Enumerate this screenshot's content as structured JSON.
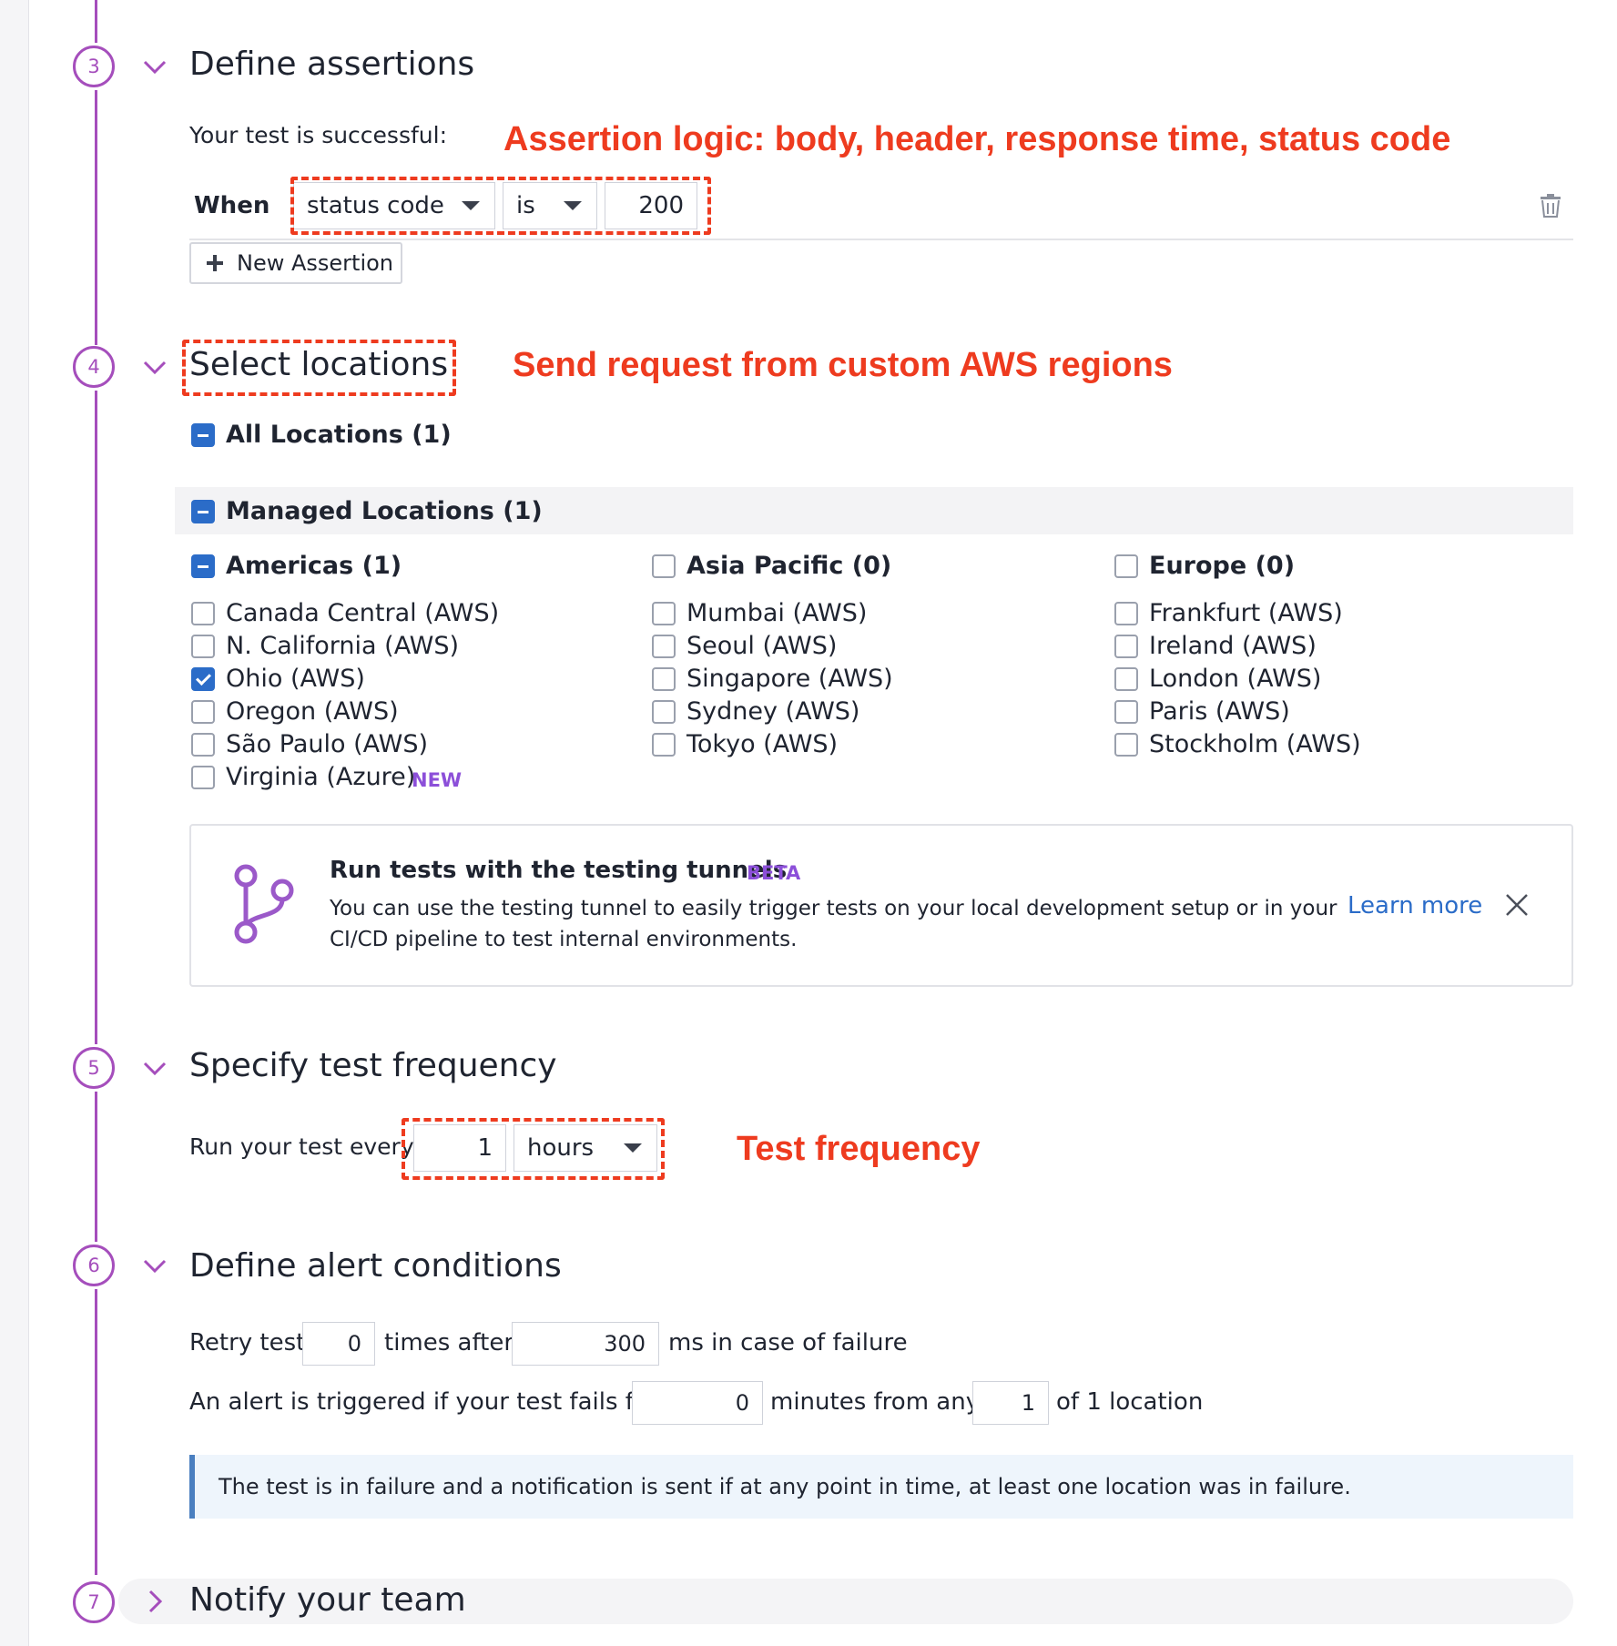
{
  "steps": [
    {
      "number": "3",
      "title": "Define assertions"
    },
    {
      "number": "4",
      "title": "Select locations"
    },
    {
      "number": "5",
      "title": "Specify test frequency"
    },
    {
      "number": "6",
      "title": "Define alert conditions"
    },
    {
      "number": "7",
      "title": "Notify your team"
    }
  ],
  "annotations": {
    "assertion": "Assertion logic: body, header, response time, status code",
    "locations": "Send request from custom AWS regions",
    "frequency": "Test frequency"
  },
  "assertions": {
    "intro": "Your test is successful:",
    "when_label": "When",
    "field": "status code",
    "operator": "is",
    "value": "200",
    "new_button": "New Assertion"
  },
  "locations": {
    "all": "All Locations (1)",
    "managed": "Managed Locations (1)",
    "regions": [
      {
        "title": "Americas (1)",
        "state": "indeterminate",
        "items": [
          {
            "label": "Canada Central (AWS)",
            "checked": false
          },
          {
            "label": "N. California (AWS)",
            "checked": false
          },
          {
            "label": "Ohio (AWS)",
            "checked": true
          },
          {
            "label": "Oregon (AWS)",
            "checked": false
          },
          {
            "label": "São Paulo (AWS)",
            "checked": false
          },
          {
            "label": "Virginia (Azure)",
            "checked": false,
            "badge": "NEW"
          }
        ]
      },
      {
        "title": "Asia Pacific (0)",
        "state": "unchecked",
        "items": [
          {
            "label": "Mumbai (AWS)",
            "checked": false
          },
          {
            "label": "Seoul (AWS)",
            "checked": false
          },
          {
            "label": "Singapore (AWS)",
            "checked": false
          },
          {
            "label": "Sydney (AWS)",
            "checked": false
          },
          {
            "label": "Tokyo (AWS)",
            "checked": false
          }
        ]
      },
      {
        "title": "Europe (0)",
        "state": "unchecked",
        "items": [
          {
            "label": "Frankfurt (AWS)",
            "checked": false
          },
          {
            "label": "Ireland (AWS)",
            "checked": false
          },
          {
            "label": "London (AWS)",
            "checked": false
          },
          {
            "label": "Paris (AWS)",
            "checked": false
          },
          {
            "label": "Stockholm (AWS)",
            "checked": false
          }
        ]
      }
    ]
  },
  "tunnel": {
    "title": "Run tests with the testing tunnels",
    "badge": "BETA",
    "line1": "You can use the testing tunnel to easily trigger tests on your local development setup or in your",
    "line2": "CI/CD pipeline to test internal environments.",
    "learn_more": "Learn more"
  },
  "frequency": {
    "label": "Run your test every",
    "value": "1",
    "unit": "hours"
  },
  "alert": {
    "retry_label": "Retry test",
    "retry_count": "0",
    "times_after": "times after",
    "retry_ms": "300",
    "ms_suffix": "ms in case of failure",
    "trigger_label": "An alert is triggered if your test fails for",
    "minutes": "0",
    "minutes_from_any": "minutes from any",
    "locations_count": "1",
    "of_locations": "of 1 location",
    "info": "The test is in failure and a notification is sent if at any point in time, at least one location was in failure."
  },
  "colors": {
    "accent": "#a54ebc",
    "annotation": "#ee3b1f",
    "checkbox": "#2b6cc8",
    "link": "#2b6cc8",
    "badge": "#8c4fd9"
  }
}
